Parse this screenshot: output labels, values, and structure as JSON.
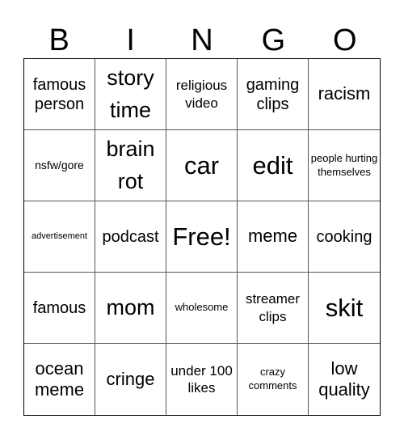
{
  "header": {
    "letters": [
      "B",
      "I",
      "N",
      "G",
      "O"
    ]
  },
  "cells": [
    {
      "text": "famous person",
      "size": "s-lg"
    },
    {
      "text": "story time",
      "size": "s-xxl"
    },
    {
      "text": "religious video",
      "size": "s-md"
    },
    {
      "text": "gaming clips",
      "size": "s-lg"
    },
    {
      "text": "racism",
      "size": "s-xl"
    },
    {
      "text": "nsfw/gore",
      "size": "s-sm2"
    },
    {
      "text": "brain rot",
      "size": "s-xxl"
    },
    {
      "text": "car",
      "size": "s-xxxl"
    },
    {
      "text": "edit",
      "size": "s-xxxl"
    },
    {
      "text": "people hurting themselves",
      "size": "s-sm"
    },
    {
      "text": "advertisement",
      "size": "s-xs"
    },
    {
      "text": "podcast",
      "size": "s-lg"
    },
    {
      "text": "Free!",
      "size": "s-xxxl"
    },
    {
      "text": "meme",
      "size": "s-xl"
    },
    {
      "text": "cooking",
      "size": "s-lg"
    },
    {
      "text": "famous",
      "size": "s-lg"
    },
    {
      "text": "mom",
      "size": "s-xxl"
    },
    {
      "text": "wholesome",
      "size": "s-sm"
    },
    {
      "text": "streamer clips",
      "size": "s-md"
    },
    {
      "text": "skit",
      "size": "s-xxxl"
    },
    {
      "text": "ocean meme",
      "size": "s-xl"
    },
    {
      "text": "cringe",
      "size": "s-xl"
    },
    {
      "text": "under 100 likes",
      "size": "s-md"
    },
    {
      "text": "crazy comments",
      "size": "s-sm"
    },
    {
      "text": "low quality",
      "size": "s-xl"
    }
  ]
}
